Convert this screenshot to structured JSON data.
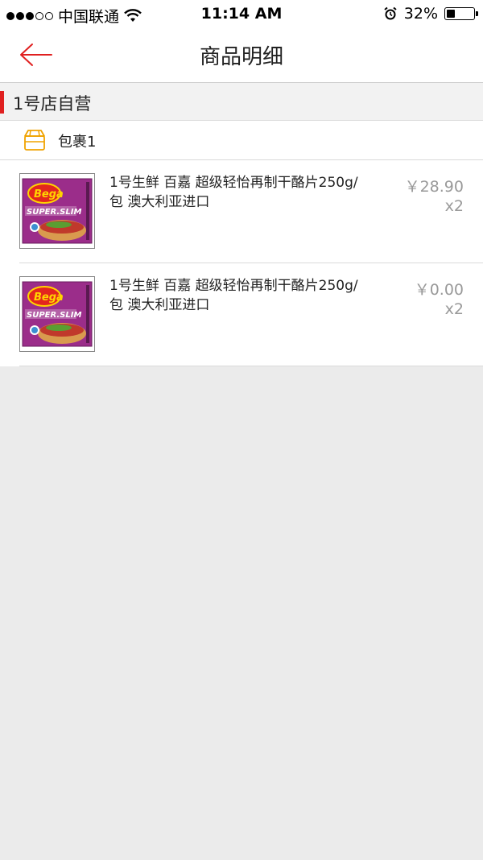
{
  "status_bar": {
    "carrier": "中国联通",
    "time": "11:14 AM",
    "battery_percent": "32%",
    "battery_level": 0.32,
    "signal_bars_filled": 3,
    "signal_bars_total": 5,
    "icons": [
      "signal-dots-icon",
      "wifi-icon",
      "alarm-icon",
      "battery-icon"
    ]
  },
  "nav": {
    "title": "商品明细",
    "back_icon": "arrow-left-icon",
    "accent_color": "#e02020"
  },
  "store": {
    "name": "1号店自营",
    "accent_color": "#e02020"
  },
  "package": {
    "label": "包裹1",
    "icon": "package-box-icon",
    "icon_color": "#f0a300"
  },
  "items": [
    {
      "name": "1号生鲜 百嘉 超级轻怡再制干酪片250g/包 澳大利亚进口",
      "price": "￥28.90",
      "quantity": "x2",
      "image": "cheese-package-icon"
    },
    {
      "name": "1号生鲜 百嘉 超级轻怡再制干酪片250g/包 澳大利亚进口",
      "price": "￥0.00",
      "quantity": "x2",
      "image": "cheese-package-icon"
    }
  ]
}
